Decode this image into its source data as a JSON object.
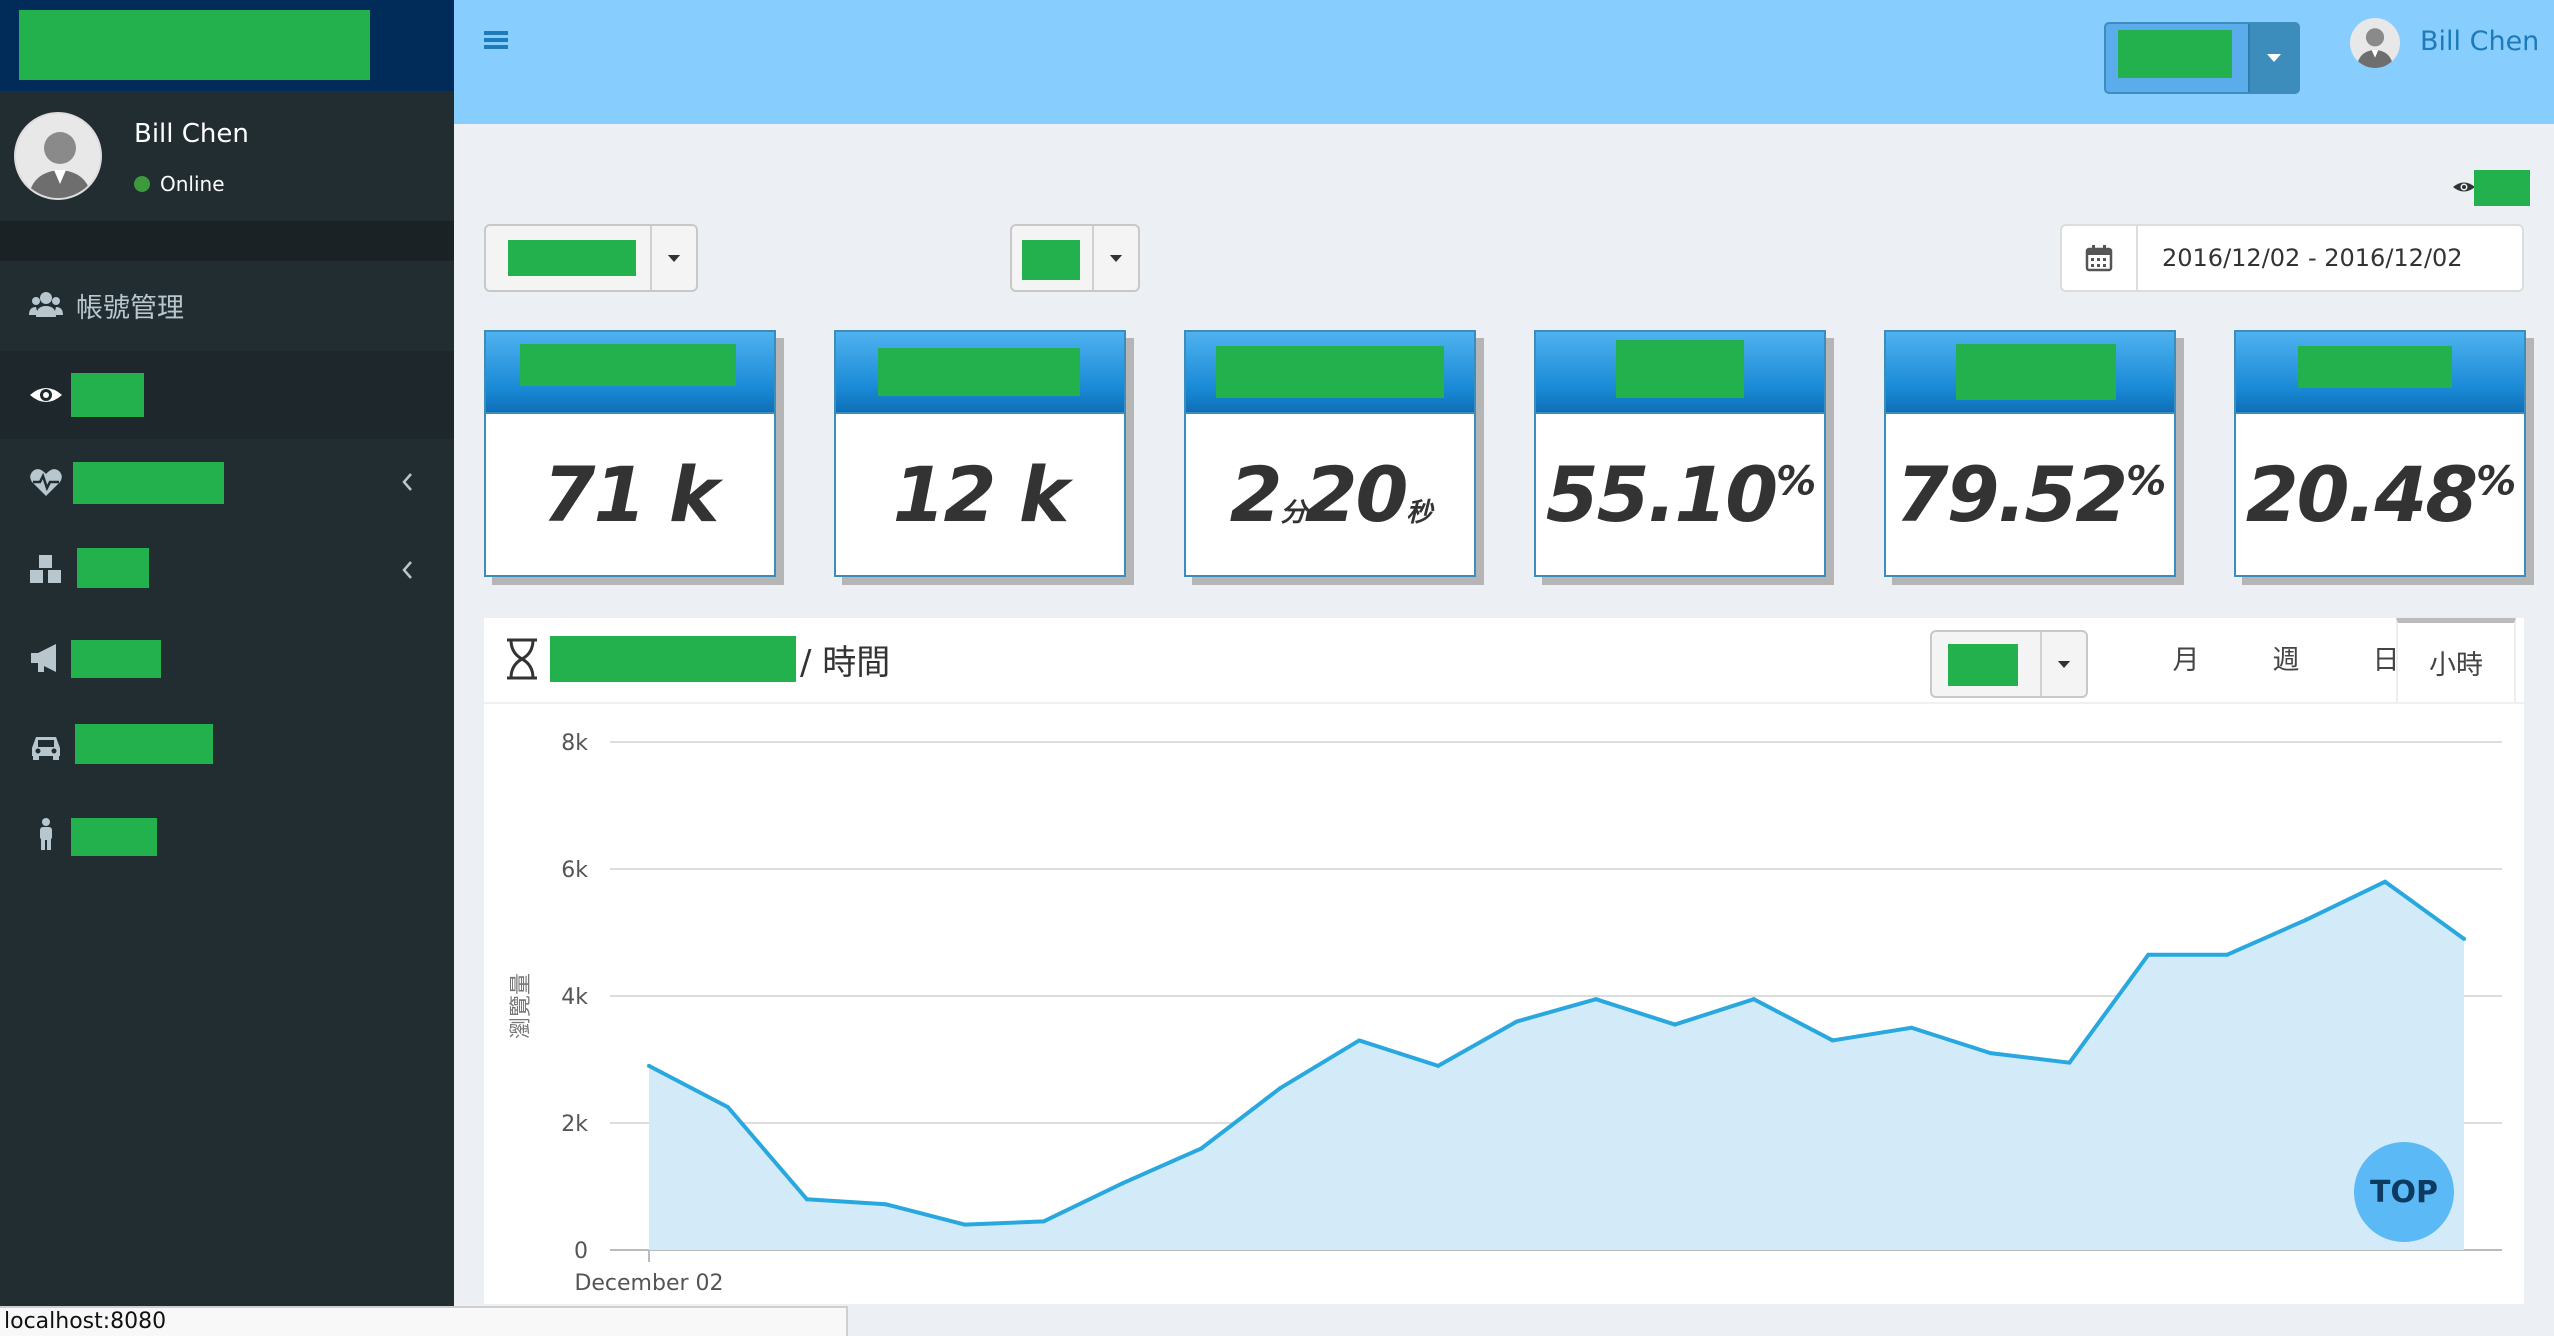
{
  "sidebar": {
    "user": {
      "name": "Bill Chen",
      "status": "Online"
    },
    "items": [
      {
        "label": "帳號管理",
        "icon": "users-icon"
      },
      {
        "label": "",
        "icon": "eye-icon"
      },
      {
        "label": "",
        "icon": "heartbeat-icon"
      },
      {
        "label": "",
        "icon": "cubes-icon"
      },
      {
        "label": "",
        "icon": "bullhorn-icon"
      },
      {
        "label": "",
        "icon": "car-icon"
      },
      {
        "label": "",
        "icon": "male-icon"
      }
    ]
  },
  "header": {
    "user_name": "Bill Chen"
  },
  "filters": {
    "date_range": "2016/12/02 - 2016/12/02"
  },
  "stats": [
    {
      "value": "71",
      "unit": " k"
    },
    {
      "value": "12",
      "unit": " k"
    },
    {
      "minutes": "2",
      "min_unit": "分",
      "seconds": "20",
      "sec_unit": "秒"
    },
    {
      "value": "55.10",
      "unit": "%"
    },
    {
      "value": "79.52",
      "unit": "%"
    },
    {
      "value": "20.48",
      "unit": "%"
    }
  ],
  "chart_box": {
    "title_suffix": "/ 時間",
    "tabs": [
      "月",
      "週",
      "日",
      "小時"
    ],
    "active_tab": "小時"
  },
  "chart_data": {
    "type": "area",
    "x_start_label": "December 02",
    "ylabel": "瀏覽量",
    "ylim": [
      0,
      8000
    ],
    "yticks": [
      "0",
      "2k",
      "4k",
      "6k",
      "8k"
    ],
    "values": [
      2900,
      2250,
      800,
      720,
      400,
      450,
      1050,
      1600,
      2550,
      3300,
      2900,
      3600,
      3950,
      3550,
      3950,
      3300,
      3500,
      3100,
      2950,
      4650,
      4650,
      5200,
      5800,
      4900
    ],
    "line_color": "#29a8e0",
    "fill_color": "#d3eaf8",
    "grid": true
  },
  "top_button": "TOP",
  "status_bar": "localhost:8080"
}
